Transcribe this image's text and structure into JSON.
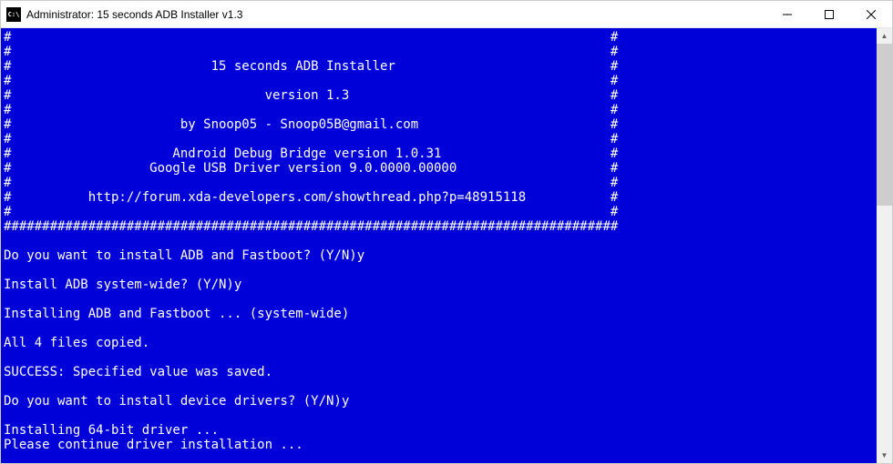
{
  "window": {
    "title": "Administrator:   15 seconds ADB Installer v1.3"
  },
  "terminal": {
    "lines": [
      "#                                                                              #",
      "#                                                                              #",
      "#                          15 seconds ADB Installer                            #",
      "#                                                                              #",
      "#                                 version 1.3                                  #",
      "#                                                                              #",
      "#                      by Snoop05 - Snoop05B@gmail.com                         #",
      "#                                                                              #",
      "#                     Android Debug Bridge version 1.0.31                      #",
      "#                  Google USB Driver version 9.0.0000.00000                    #",
      "#                                                                              #",
      "#          http://forum.xda-developers.com/showthread.php?p=48915118           #",
      "#                                                                              #",
      "################################################################################",
      "",
      "Do you want to install ADB and Fastboot? (Y/N)y",
      "",
      "Install ADB system-wide? (Y/N)y",
      "",
      "Installing ADB and Fastboot ... (system-wide)",
      "",
      "All 4 files copied.",
      "",
      "SUCCESS: Specified value was saved.",
      "",
      "Do you want to install device drivers? (Y/N)y",
      "",
      "Installing 64-bit driver ...",
      "Please continue driver installation ..."
    ]
  }
}
